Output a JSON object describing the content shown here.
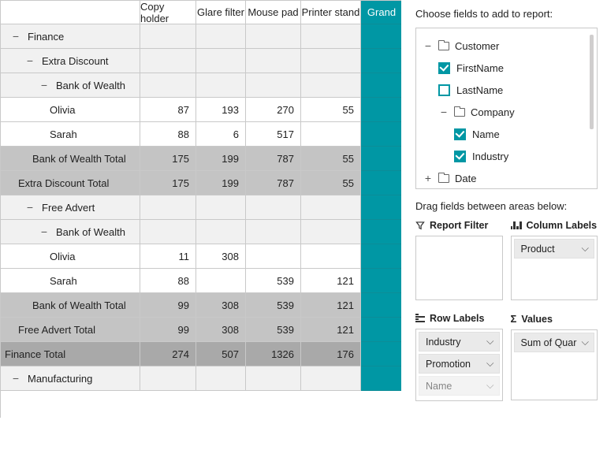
{
  "columns": [
    "Copy holder",
    "Glare filter",
    "Mouse pad",
    "Printer stand",
    "Grand"
  ],
  "rows": [
    {
      "type": "group",
      "level": 0,
      "label": "Finance",
      "exp": "−"
    },
    {
      "type": "group",
      "level": 1,
      "label": "Extra Discount",
      "exp": "−"
    },
    {
      "type": "group",
      "level": 2,
      "label": "Bank of Wealth",
      "exp": "−"
    },
    {
      "type": "leaf",
      "level": 3,
      "label": "Olivia",
      "vals": [
        "87",
        "193",
        "270",
        "55"
      ]
    },
    {
      "type": "leaf",
      "level": 3,
      "label": "Sarah",
      "vals": [
        "88",
        "6",
        "517",
        ""
      ]
    },
    {
      "type": "total",
      "level": 2,
      "label": "Bank of Wealth Total",
      "vals": [
        "175",
        "199",
        "787",
        "55"
      ]
    },
    {
      "type": "total",
      "level": 1,
      "label": "Extra Discount Total",
      "vals": [
        "175",
        "199",
        "787",
        "55"
      ]
    },
    {
      "type": "group",
      "level": 1,
      "label": "Free Advert",
      "exp": "−"
    },
    {
      "type": "group",
      "level": 2,
      "label": "Bank of Wealth",
      "exp": "−"
    },
    {
      "type": "leaf",
      "level": 3,
      "label": "Olivia",
      "vals": [
        "11",
        "308",
        "",
        ""
      ]
    },
    {
      "type": "leaf",
      "level": 3,
      "label": "Sarah",
      "vals": [
        "88",
        "",
        "539",
        "121"
      ]
    },
    {
      "type": "total",
      "level": 2,
      "label": "Bank of Wealth Total",
      "vals": [
        "99",
        "308",
        "539",
        "121"
      ]
    },
    {
      "type": "total",
      "level": 1,
      "label": "Free Advert Total",
      "vals": [
        "99",
        "308",
        "539",
        "121"
      ]
    },
    {
      "type": "grand",
      "level": 0,
      "label": "Finance Total",
      "vals": [
        "274",
        "507",
        "1326",
        "176"
      ]
    },
    {
      "type": "group",
      "level": 0,
      "label": "Manufacturing",
      "exp": "−"
    }
  ],
  "field_panel": {
    "title": "Choose fields to add to report:",
    "drag_title": "Drag fields between areas below:",
    "tree": {
      "customer": "Customer",
      "firstname": "FirstName",
      "lastname": "LastName",
      "company": "Company",
      "name": "Name",
      "industry": "Industry",
      "date": "Date"
    },
    "areas": {
      "filter": "Report Filter",
      "cols": "Column Labels",
      "rows": "Row Labels",
      "vals": "Values"
    },
    "chips": {
      "product": "Product",
      "industry": "Industry",
      "promotion": "Promotion",
      "name": "Name",
      "sumquar": "Sum of Quar"
    }
  }
}
